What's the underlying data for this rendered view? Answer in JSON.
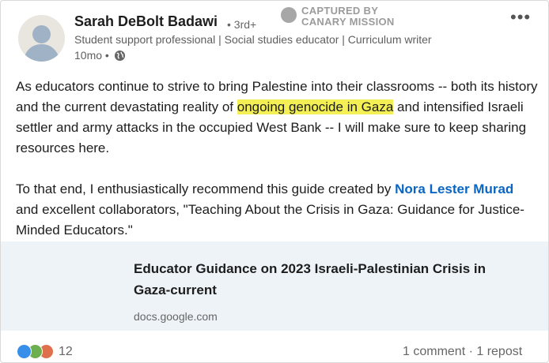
{
  "post": {
    "author": {
      "name": "Sarah DeBolt Badawi",
      "degree": "• 3rd+",
      "headline": "Student support professional | Social studies educator | Curriculum writer",
      "time": "10mo •"
    },
    "watermark": {
      "line1": "CAPTURED BY",
      "line2": "CANARY MISSION"
    },
    "more_menu": "•••",
    "body": {
      "p1_before": "As educators continue to strive to bring Palestine into their classrooms -- both its history and the current devastating reality of ",
      "p1_highlight": "ongoing genocide in Gaza",
      "p1_after": " and intensified Israeli settler and army attacks in the occupied West Bank -- I will make sure to keep sharing resources here.",
      "p2_before": "To that end, I enthusiastically recommend this guide created by ",
      "p2_mention": "Nora Lester Murad",
      "p2_after": " and excellent collaborators, \"Teaching About the Crisis in Gaza: Guidance for Justice-Minded Educators.\""
    },
    "link_card": {
      "title": "Educator Guidance on 2023 Israeli-Palestinian Crisis in Gaza-current",
      "domain": "docs.google.com"
    },
    "reactions": {
      "icons": [
        "like-icon",
        "celebrate-icon",
        "love-icon"
      ],
      "count": "12"
    },
    "social": {
      "comments": "1 comment",
      "separator": " · ",
      "reposts": "1 repost"
    }
  },
  "colors": {
    "highlight": "#f3ef55",
    "mention": "#0a66c2",
    "link_card_bg": "#eef3f8"
  }
}
